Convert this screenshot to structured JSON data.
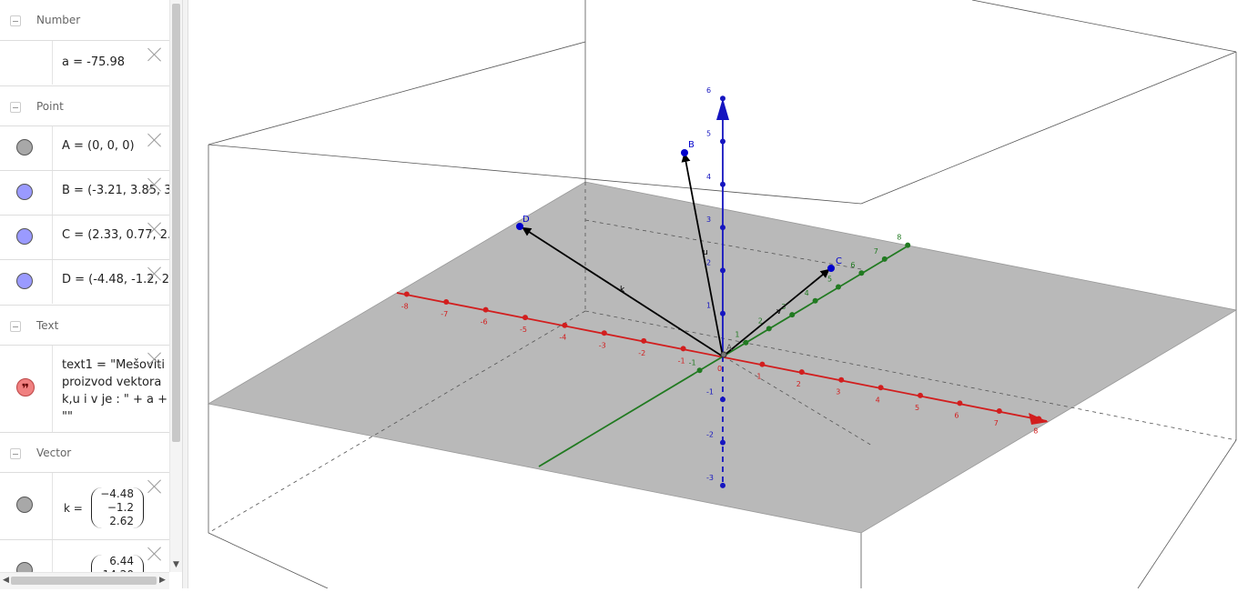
{
  "algebra": {
    "categories": {
      "number": "Number",
      "point": "Point",
      "text": "Text",
      "vector": "Vector"
    },
    "number_a": "a = -75.98",
    "points": {
      "A": "A = (0, 0, 0)",
      "B": "B = (-3.21, 3.85, 3)",
      "C": "C = (2.33, 0.77, 2.2",
      "D": "D = (-4.48, -1.2, 2.6"
    },
    "text1": "text1 = \"Mešoviti\nproizvod vektora\nk,u i v je : \" + a +\n\"\"",
    "vector_k": {
      "name": "k =",
      "values": [
        "−4.48",
        "−1.2",
        "2.62"
      ]
    },
    "vector_u": {
      "name": "u =",
      "values": [
        "6.44",
        "14.20"
      ]
    },
    "colors": {
      "gray_marble": "#a8a8a8",
      "blue_marble": "#9a9aff",
      "text_marble": "#f08080"
    }
  },
  "view3d": {
    "x_ticks": [
      "-8",
      "-7",
      "-6",
      "-5",
      "-4",
      "-3",
      "-2",
      "-1",
      "0",
      "1",
      "2",
      "3",
      "4",
      "5",
      "6",
      "7",
      "8"
    ],
    "y_ticks": [
      "-1",
      "1",
      "2",
      "3",
      "4",
      "5",
      "6",
      "7",
      "8"
    ],
    "z_ticks": [
      "-3",
      "-2",
      "-1",
      "1",
      "2",
      "3",
      "4",
      "5",
      "6"
    ],
    "point_labels": {
      "A": "A",
      "B": "B",
      "C": "C",
      "D": "D"
    },
    "vector_labels": {
      "k": "k",
      "u": "u",
      "v": "v"
    },
    "colors": {
      "x_axis": "#d21e1e",
      "y_axis": "#217a21",
      "z_axis": "#1515c0",
      "plane": "#b9b9b9",
      "point": "#0000cc"
    }
  }
}
